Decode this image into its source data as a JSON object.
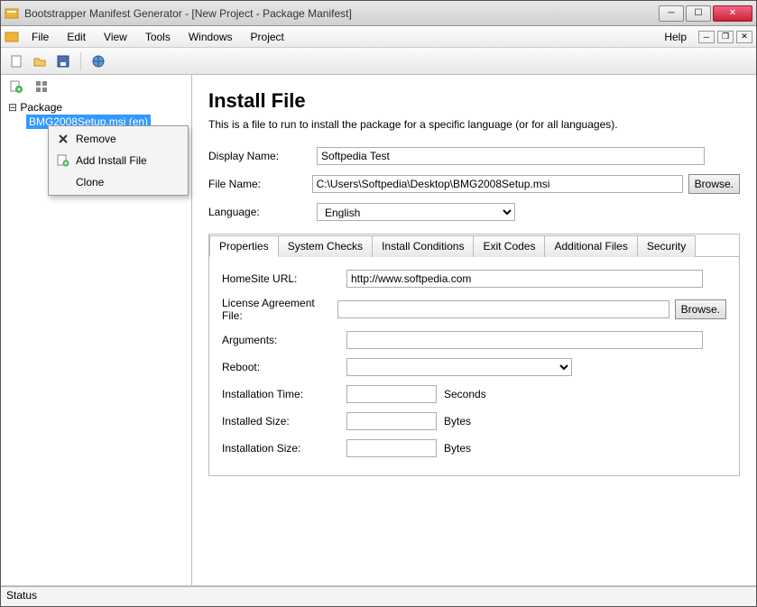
{
  "window": {
    "title": "Bootstrapper Manifest Generator - [New Project - Package Manifest]"
  },
  "menu": {
    "file": "File",
    "edit": "Edit",
    "view": "View",
    "tools": "Tools",
    "windows": "Windows",
    "project": "Project",
    "help": "Help"
  },
  "tree": {
    "root": "Package",
    "child": "BMG2008Setup.msi  (en)"
  },
  "context_menu": {
    "remove": "Remove",
    "add_install": "Add Install File",
    "clone": "Clone"
  },
  "main": {
    "title": "Install File",
    "description": "This is a file to run to install the package for a specific language (or for all languages).",
    "display_name_label": "Display Name:",
    "display_name_value": "Softpedia Test",
    "file_name_label": "File Name:",
    "file_name_value": "C:\\Users\\Softpedia\\Desktop\\BMG2008Setup.msi",
    "browse": "Browse.",
    "language_label": "Language:",
    "language_value": "English"
  },
  "tabs": {
    "properties": "Properties",
    "system_checks": "System Checks",
    "install_conditions": "Install Conditions",
    "exit_codes": "Exit Codes",
    "additional_files": "Additional Files",
    "security": "Security"
  },
  "properties": {
    "homesite_label": "HomeSite URL:",
    "homesite_value": "http://www.softpedia.com",
    "license_label": "License Agreement File:",
    "license_value": "",
    "browse": "Browse.",
    "arguments_label": "Arguments:",
    "arguments_value": "",
    "reboot_label": "Reboot:",
    "reboot_value": "",
    "install_time_label": "Installation Time:",
    "install_time_value": "",
    "install_time_unit": "Seconds",
    "installed_size_label": "Installed Size:",
    "installed_size_value": "",
    "installed_size_unit": "Bytes",
    "installation_size_label": "Installation Size:",
    "installation_size_value": "",
    "installation_size_unit": "Bytes"
  },
  "status": "Status"
}
